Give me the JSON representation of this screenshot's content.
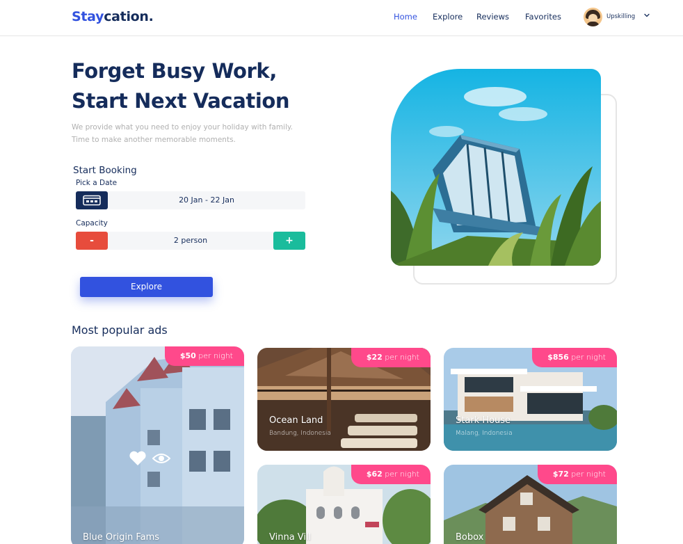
{
  "brand": {
    "part1": "Stay",
    "part2": "cation."
  },
  "nav": {
    "items": [
      "Home",
      "Explore",
      "Reviews",
      "Favorites"
    ],
    "active": "Home",
    "user_name": "Upskilling"
  },
  "hero": {
    "title_line1": "Forget Busy Work,",
    "title_line2": "Start Next Vacation",
    "desc_line1": "We provide what you need to enjoy your holiday with family.",
    "desc_line2": "Time to make another memorable moments."
  },
  "booking": {
    "title": "Start Booking",
    "date_label": "Pick a Date",
    "date_value": "20 Jan - 22 Jan",
    "capacity_label": "Capacity",
    "capacity_value": "2 person",
    "minus": "-",
    "plus": "+",
    "explore_label": "Explore"
  },
  "popular": {
    "title": "Most popular ads",
    "cards": [
      {
        "price": "$50",
        "per": " per night",
        "name": "Blue Origin Fams",
        "location": ""
      },
      {
        "price": "$22",
        "per": " per night",
        "name": "Ocean Land",
        "location": "Bandung, Indonesia"
      },
      {
        "price": "$856",
        "per": " per night",
        "name": "Stark House",
        "location": "Malang, Indonesia"
      },
      {
        "price": "$62",
        "per": " per night",
        "name": "Vinna Vill",
        "location": ""
      },
      {
        "price": "$72",
        "per": " per night",
        "name": "Bobox",
        "location": ""
      }
    ]
  },
  "colors": {
    "primary": "#3252df",
    "dark": "#152c5b",
    "pink": "#ff498b",
    "red": "#e74c3c",
    "green": "#1abc9c",
    "muted": "#b0b0b0"
  },
  "icons": [
    "calendar-icon",
    "heart-icon",
    "eye-icon",
    "chevron-down-icon"
  ]
}
